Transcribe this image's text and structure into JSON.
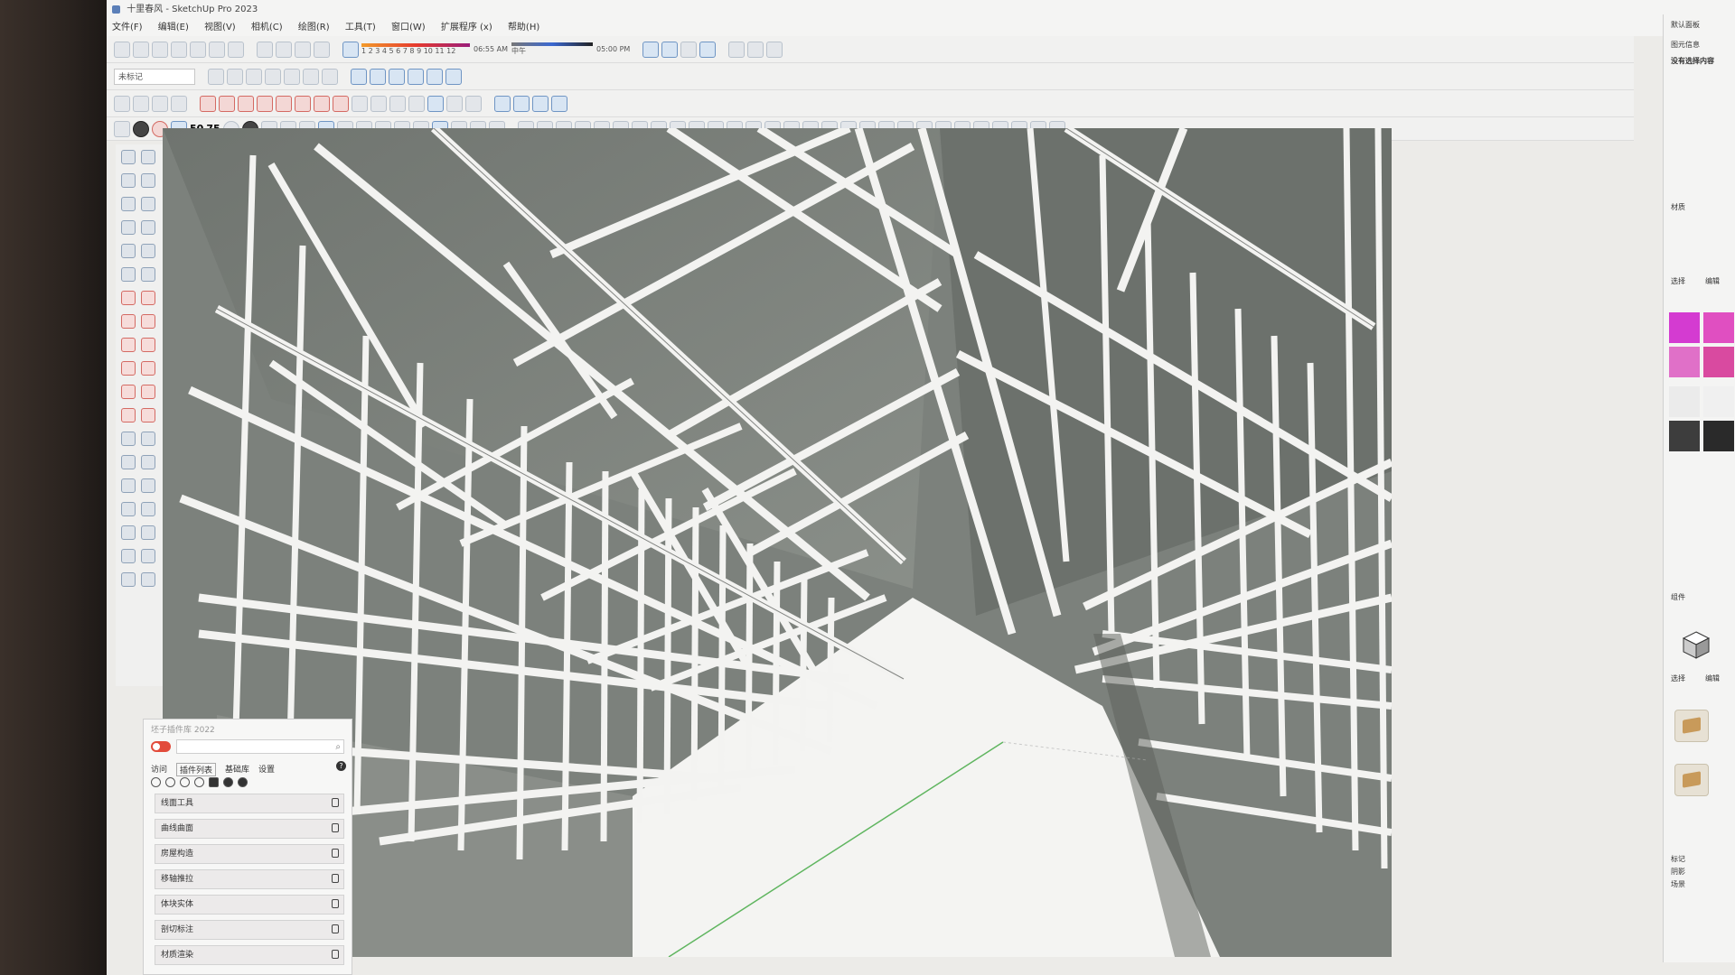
{
  "window": {
    "title": "十里春风 - SketchUp Pro 2023"
  },
  "menu": [
    "文件(F)",
    "编辑(E)",
    "视图(V)",
    "相机(C)",
    "绘图(R)",
    "工具(T)",
    "窗口(W)",
    "扩展程序 (x)",
    "帮助(H)"
  ],
  "toolbar": {
    "layer_value": "未标记",
    "sun_months": "1 2 3 4 5 6 7 8 9 10 11 12",
    "time_start": "06:55 AM",
    "time_mid": "中午",
    "time_end": "05:00 PM",
    "icon_50": "50",
    "icon_75": "75"
  },
  "plugin_panel": {
    "title": "坯子插件库 2022",
    "tabs": [
      "访问",
      "插件列表",
      "基础库",
      "设置"
    ],
    "items": [
      "线面工具",
      "曲线曲面",
      "房屋构造",
      "移轴推拉",
      "体块实体",
      "剖切标注",
      "材质渲染"
    ]
  },
  "tray": {
    "default_panel": "默认面板",
    "entity_info": "图元信息",
    "no_selection": "没有选择内容",
    "materials": "材质",
    "select": "选择",
    "edit": "编辑",
    "components": "组件",
    "select2": "选择",
    "edit2": "编辑",
    "tags": "标记",
    "shadows": "阴影",
    "scenes": "场景",
    "swatches": [
      "#d43bd1",
      "#e04fc1",
      "#e070c8",
      "#d94aa0",
      "#ebebeb",
      "#f0f0f0",
      "#3d3d3d",
      "#2a2a2a"
    ]
  },
  "colors": {
    "accent_red": "#e24b3b",
    "viewport_bg": "#7f847f",
    "beam": "#f3f3f1"
  }
}
